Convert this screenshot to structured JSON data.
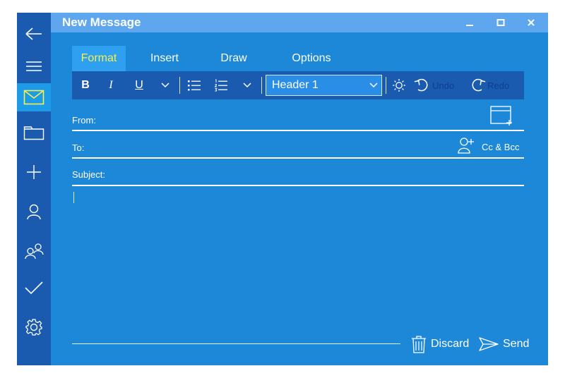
{
  "window": {
    "title": "New Message"
  },
  "sidebar": {
    "items": [
      {
        "name": "back-arrow-icon"
      },
      {
        "name": "hamburger-menu-icon"
      },
      {
        "name": "mail-icon",
        "active": true
      },
      {
        "name": "folder-icon"
      },
      {
        "name": "plus-icon"
      },
      {
        "name": "person-icon"
      },
      {
        "name": "people-icon"
      },
      {
        "name": "checkmark-icon"
      },
      {
        "name": "gear-icon"
      }
    ]
  },
  "tabs": [
    {
      "label": "Format",
      "active": true
    },
    {
      "label": "Insert"
    },
    {
      "label": "Draw"
    },
    {
      "label": "Options"
    }
  ],
  "toolbar": {
    "bold": "B",
    "italic": "I",
    "underline": "U",
    "style_value": "Header 1",
    "undo_label": "Undo",
    "redo_label": "Redo"
  },
  "fields": {
    "from_label": "From:",
    "to_label": "To:",
    "subject_label": "Subject:",
    "cc_bcc_label": "Cc & Bcc"
  },
  "actions": {
    "discard_label": "Discard",
    "send_label": "Send"
  },
  "colors": {
    "sidebar": "#1a5bb0",
    "content": "#1e88d8",
    "titlebar": "#5ea7ee",
    "active_tab_text": "#f5f04a"
  }
}
